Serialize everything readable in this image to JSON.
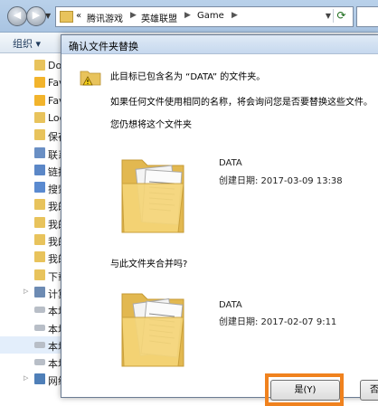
{
  "explorer": {
    "breadcrumb": [
      "腾讯游戏",
      "英雄联盟",
      "Game"
    ],
    "breadcrumb_prefix": "«",
    "organize_label": "组织 ▾",
    "nav_items": [
      {
        "label": "Do",
        "icon": "folder-icon"
      },
      {
        "label": "Fav",
        "icon": "star-folder-icon"
      },
      {
        "label": "Fav",
        "icon": "star-folder-icon"
      },
      {
        "label": "Loc",
        "icon": "folder-icon"
      },
      {
        "label": "保存",
        "icon": "folder-icon"
      },
      {
        "label": "联系",
        "icon": "contacts-icon"
      },
      {
        "label": "链接",
        "icon": "links-icon"
      },
      {
        "label": "搜索",
        "icon": "search-folder-icon"
      },
      {
        "label": "我的",
        "icon": "folder-icon"
      },
      {
        "label": "我的",
        "icon": "folder-icon"
      },
      {
        "label": "我的",
        "icon": "folder-icon"
      },
      {
        "label": "我的",
        "icon": "folder-icon"
      },
      {
        "label": "下载",
        "icon": "download-icon"
      },
      {
        "label": "计算",
        "icon": "computer-icon"
      },
      {
        "label": "本地",
        "icon": "drive-icon"
      },
      {
        "label": "本地",
        "icon": "drive-icon"
      },
      {
        "label": "本地",
        "icon": "drive-icon"
      },
      {
        "label": "本地",
        "icon": "drive-icon"
      },
      {
        "label": "网络",
        "icon": "network-icon"
      }
    ]
  },
  "dialog": {
    "title": "确认文件夹替换",
    "message_line1": "此目标已包含名为 “DATA” 的文件夹。",
    "message_line2": "如果任何文件使用相同的名称，将会询问您是否要替换这些文件。",
    "question1": "您仍想将这个文件夹",
    "question2": "与此文件夹合并吗?",
    "source_folder": {
      "name": "DATA",
      "date_label": "创建日期: 2017-03-09 13:38"
    },
    "target_folder": {
      "name": "DATA",
      "date_label": "创建日期: 2017-02-07 9:11"
    },
    "yes_button": "是(Y)",
    "no_button": "否",
    "accent_color": "#f0821e"
  }
}
